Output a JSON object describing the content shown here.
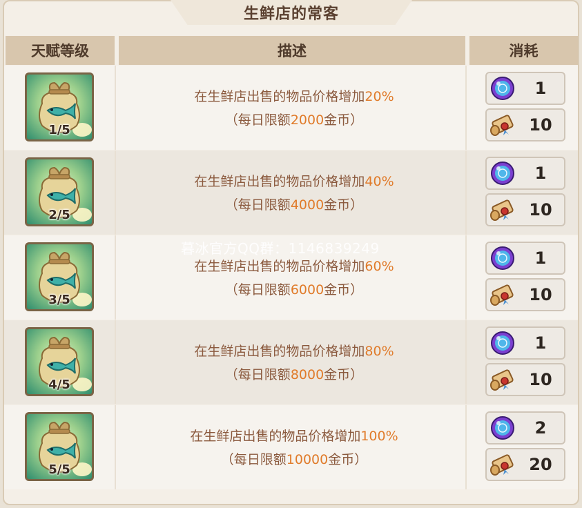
{
  "title": "生鲜店的常客",
  "columns": {
    "level": "天赋等级",
    "desc": "描述",
    "cost": "消耗"
  },
  "rows": [
    {
      "level": "1/5",
      "line1_prefix": "在生鲜店出售的物品价格增加",
      "bonus": "20%",
      "line2_prefix": "（每日限额",
      "cap": "2000",
      "line2_suffix": "金币）",
      "orb": "1",
      "scroll": "10"
    },
    {
      "level": "2/5",
      "line1_prefix": "在生鲜店出售的物品价格增加",
      "bonus": "40%",
      "line2_prefix": "（每日限额",
      "cap": "4000",
      "line2_suffix": "金币）",
      "orb": "1",
      "scroll": "10"
    },
    {
      "level": "3/5",
      "line1_prefix": "在生鲜店出售的物品价格增加",
      "bonus": "60%",
      "line2_prefix": "（每日限额",
      "cap": "6000",
      "line2_suffix": "金币）",
      "orb": "1",
      "scroll": "10"
    },
    {
      "level": "4/5",
      "line1_prefix": "在生鲜店出售的物品价格增加",
      "bonus": "80%",
      "line2_prefix": "（每日限额",
      "cap": "8000",
      "line2_suffix": "金币）",
      "orb": "1",
      "scroll": "10"
    },
    {
      "level": "5/5",
      "line1_prefix": "在生鲜店出售的物品价格增加",
      "bonus": "100%",
      "line2_prefix": "（每日限额",
      "cap": "10000",
      "line2_suffix": "金币）",
      "orb": "2",
      "scroll": "20"
    }
  ],
  "watermark": "暮冰官方QQ群：1146839249",
  "icons": {
    "talent": "fish-bag-icon",
    "cost_a": "magic-orb-icon",
    "cost_b": "scroll-icon"
  },
  "colors": {
    "highlight": "#e07b2a",
    "desc_text": "#8b5a3e",
    "header_bg": "#d8c6ad"
  }
}
